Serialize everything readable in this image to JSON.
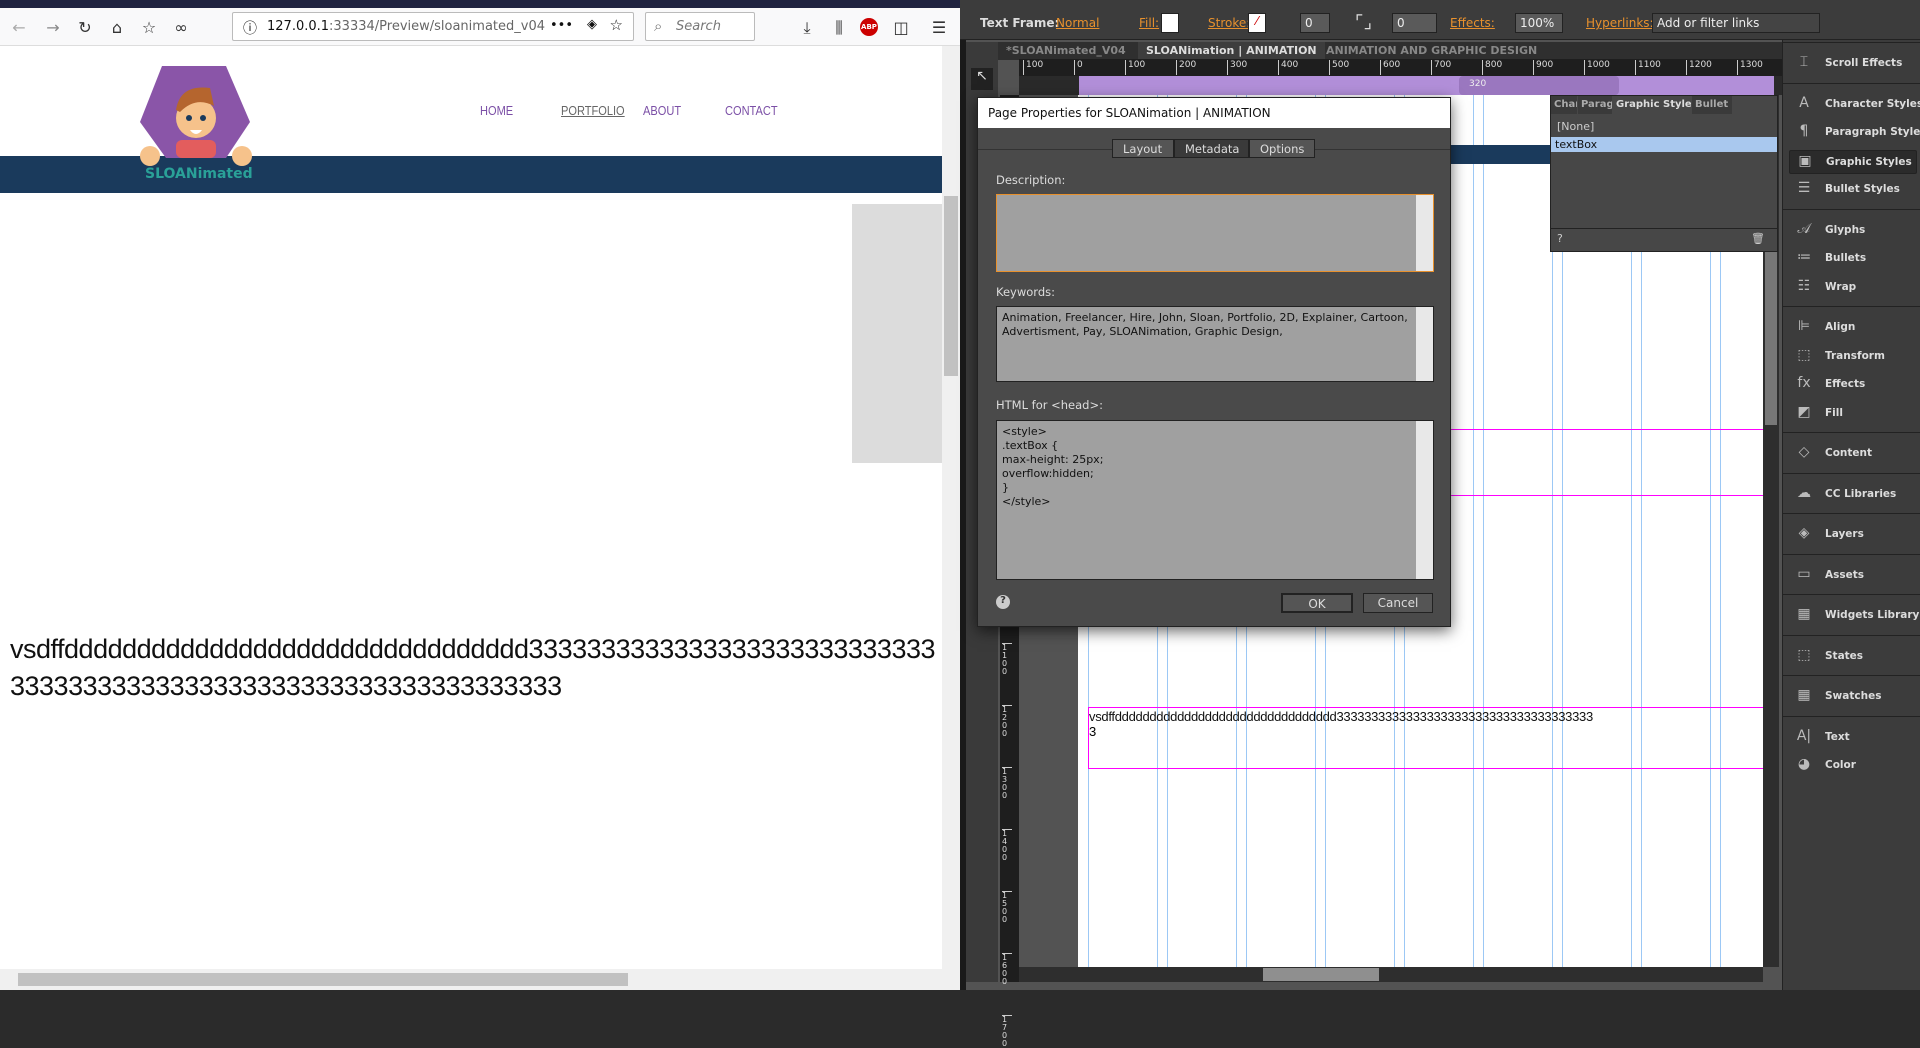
{
  "browser": {
    "url_host": "127.0.0.1",
    "url_rest": ":33334/Preview/sloanimated_v04",
    "search_placeholder": "Search",
    "abp_label": "ABP"
  },
  "site": {
    "logo_text": "SLOANimated",
    "nav": [
      {
        "label": "HOME"
      },
      {
        "label": "PORTFOLIO"
      },
      {
        "label": "ABOUT"
      },
      {
        "label": "CONTACT"
      }
    ],
    "body_text": "vsdffdddddddddddddddddddddddddddddddd333333333333333333333333333333333333333333333333333333333333333333",
    "colors": {
      "nav": "#7b4fa6",
      "band": "#1a3a5c"
    }
  },
  "muse": {
    "control_bar": {
      "text_frame_label": "Text Frame:",
      "text_frame_value": "Normal",
      "fill_label": "Fill:",
      "stroke_label": "Stroke:",
      "stroke_value": "0",
      "corner_value": "0",
      "effects_label": "Effects:",
      "opacity": "100%",
      "hyperlinks_label": "Hyperlinks:",
      "hyperlinks_placeholder": "Add or filter links"
    },
    "doc_tabs": [
      {
        "label": "*SLOANimated_V04"
      },
      {
        "label": "SLOANimation | ANIMATION"
      },
      {
        "label": "ANIMATION AND GRAPHIC DESIGN"
      }
    ],
    "ruler_ticks": [
      "100",
      "0",
      "100",
      "200",
      "300",
      "400",
      "500",
      "600",
      "700",
      "800",
      "900",
      "1000",
      "1100",
      "1200",
      "1300"
    ],
    "vruler_ticks": [
      "1100",
      "1200",
      "1300",
      "1400",
      "1500",
      "1600",
      "1700"
    ],
    "breakpoint_label": "320",
    "canvas_text": "vsdffdddddddddddddddddddddddddddddddd3333333333333333333333333333333333333",
    "canvas_text_line2": "3",
    "graphic_styles_panel": {
      "tabs": [
        "Chara",
        "Parag",
        "Graphic Styles",
        "Bullet"
      ],
      "items": [
        "[None]",
        "textBox"
      ],
      "selected": "textBox"
    },
    "right_panel": [
      {
        "label": "Scroll Effects",
        "icon": "scroll-effects-icon"
      },
      {
        "label": "Character Styles",
        "icon": "character-styles-icon"
      },
      {
        "label": "Paragraph Styles",
        "icon": "paragraph-styles-icon"
      },
      {
        "label": "Graphic Styles",
        "icon": "graphic-styles-icon"
      },
      {
        "label": "Bullet Styles",
        "icon": "bullet-styles-icon"
      },
      {
        "label": "Glyphs",
        "icon": "glyphs-icon"
      },
      {
        "label": "Bullets",
        "icon": "bullets-icon"
      },
      {
        "label": "Wrap",
        "icon": "wrap-icon"
      },
      {
        "label": "Align",
        "icon": "align-icon"
      },
      {
        "label": "Transform",
        "icon": "transform-icon"
      },
      {
        "label": "Effects",
        "icon": "effects-icon"
      },
      {
        "label": "Fill",
        "icon": "fill-icon"
      },
      {
        "label": "Content",
        "icon": "content-icon"
      },
      {
        "label": "CC Libraries",
        "icon": "cc-libraries-icon"
      },
      {
        "label": "Layers",
        "icon": "layers-icon"
      },
      {
        "label": "Assets",
        "icon": "assets-icon"
      },
      {
        "label": "Widgets Library",
        "icon": "widgets-library-icon"
      },
      {
        "label": "States",
        "icon": "states-icon"
      },
      {
        "label": "Swatches",
        "icon": "swatches-icon"
      },
      {
        "label": "Text",
        "icon": "text-icon"
      },
      {
        "label": "Color",
        "icon": "color-icon"
      }
    ]
  },
  "dialog": {
    "title": "Page Properties for SLOANimation | ANIMATION",
    "tabs": [
      "Layout",
      "Metadata",
      "Options"
    ],
    "active_tab": "Metadata",
    "description_label": "Description:",
    "description_value": "",
    "keywords_label": "Keywords:",
    "keywords_value": "Animation, Freelancer, Hire, John, Sloan, Portfolio, 2D, Explainer, Cartoon, Advertisment, Pay, SLOANimation, Graphic Design,",
    "head_label": "HTML for <head>:",
    "head_value": "<style>\n.textBox {\nmax-height: 25px;\noverflow:hidden;\n}\n</style>",
    "ok_label": "OK",
    "cancel_label": "Cancel"
  }
}
